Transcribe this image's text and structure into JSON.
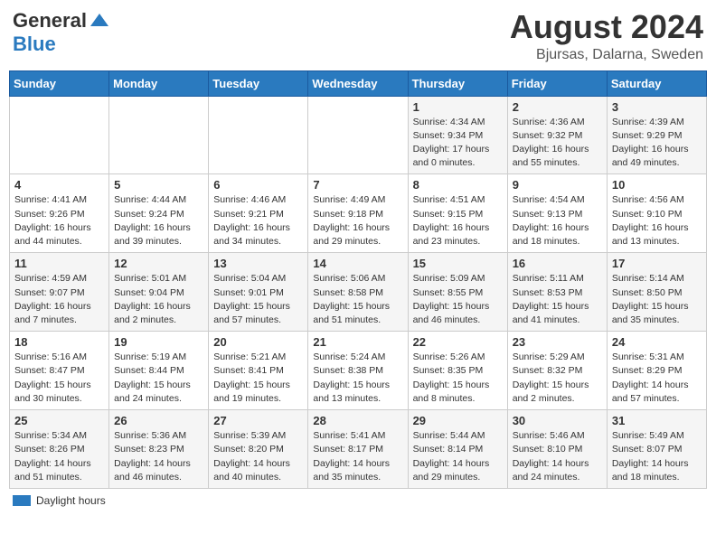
{
  "header": {
    "logo_general": "General",
    "logo_blue": "Blue",
    "month_year": "August 2024",
    "location": "Bjursas, Dalarna, Sweden"
  },
  "legend": {
    "label": "Daylight hours"
  },
  "days_of_week": [
    "Sunday",
    "Monday",
    "Tuesday",
    "Wednesday",
    "Thursday",
    "Friday",
    "Saturday"
  ],
  "weeks": [
    [
      {
        "day": "",
        "info": ""
      },
      {
        "day": "",
        "info": ""
      },
      {
        "day": "",
        "info": ""
      },
      {
        "day": "",
        "info": ""
      },
      {
        "day": "1",
        "info": "Sunrise: 4:34 AM\nSunset: 9:34 PM\nDaylight: 17 hours\nand 0 minutes."
      },
      {
        "day": "2",
        "info": "Sunrise: 4:36 AM\nSunset: 9:32 PM\nDaylight: 16 hours\nand 55 minutes."
      },
      {
        "day": "3",
        "info": "Sunrise: 4:39 AM\nSunset: 9:29 PM\nDaylight: 16 hours\nand 49 minutes."
      }
    ],
    [
      {
        "day": "4",
        "info": "Sunrise: 4:41 AM\nSunset: 9:26 PM\nDaylight: 16 hours\nand 44 minutes."
      },
      {
        "day": "5",
        "info": "Sunrise: 4:44 AM\nSunset: 9:24 PM\nDaylight: 16 hours\nand 39 minutes."
      },
      {
        "day": "6",
        "info": "Sunrise: 4:46 AM\nSunset: 9:21 PM\nDaylight: 16 hours\nand 34 minutes."
      },
      {
        "day": "7",
        "info": "Sunrise: 4:49 AM\nSunset: 9:18 PM\nDaylight: 16 hours\nand 29 minutes."
      },
      {
        "day": "8",
        "info": "Sunrise: 4:51 AM\nSunset: 9:15 PM\nDaylight: 16 hours\nand 23 minutes."
      },
      {
        "day": "9",
        "info": "Sunrise: 4:54 AM\nSunset: 9:13 PM\nDaylight: 16 hours\nand 18 minutes."
      },
      {
        "day": "10",
        "info": "Sunrise: 4:56 AM\nSunset: 9:10 PM\nDaylight: 16 hours\nand 13 minutes."
      }
    ],
    [
      {
        "day": "11",
        "info": "Sunrise: 4:59 AM\nSunset: 9:07 PM\nDaylight: 16 hours\nand 7 minutes."
      },
      {
        "day": "12",
        "info": "Sunrise: 5:01 AM\nSunset: 9:04 PM\nDaylight: 16 hours\nand 2 minutes."
      },
      {
        "day": "13",
        "info": "Sunrise: 5:04 AM\nSunset: 9:01 PM\nDaylight: 15 hours\nand 57 minutes."
      },
      {
        "day": "14",
        "info": "Sunrise: 5:06 AM\nSunset: 8:58 PM\nDaylight: 15 hours\nand 51 minutes."
      },
      {
        "day": "15",
        "info": "Sunrise: 5:09 AM\nSunset: 8:55 PM\nDaylight: 15 hours\nand 46 minutes."
      },
      {
        "day": "16",
        "info": "Sunrise: 5:11 AM\nSunset: 8:53 PM\nDaylight: 15 hours\nand 41 minutes."
      },
      {
        "day": "17",
        "info": "Sunrise: 5:14 AM\nSunset: 8:50 PM\nDaylight: 15 hours\nand 35 minutes."
      }
    ],
    [
      {
        "day": "18",
        "info": "Sunrise: 5:16 AM\nSunset: 8:47 PM\nDaylight: 15 hours\nand 30 minutes."
      },
      {
        "day": "19",
        "info": "Sunrise: 5:19 AM\nSunset: 8:44 PM\nDaylight: 15 hours\nand 24 minutes."
      },
      {
        "day": "20",
        "info": "Sunrise: 5:21 AM\nSunset: 8:41 PM\nDaylight: 15 hours\nand 19 minutes."
      },
      {
        "day": "21",
        "info": "Sunrise: 5:24 AM\nSunset: 8:38 PM\nDaylight: 15 hours\nand 13 minutes."
      },
      {
        "day": "22",
        "info": "Sunrise: 5:26 AM\nSunset: 8:35 PM\nDaylight: 15 hours\nand 8 minutes."
      },
      {
        "day": "23",
        "info": "Sunrise: 5:29 AM\nSunset: 8:32 PM\nDaylight: 15 hours\nand 2 minutes."
      },
      {
        "day": "24",
        "info": "Sunrise: 5:31 AM\nSunset: 8:29 PM\nDaylight: 14 hours\nand 57 minutes."
      }
    ],
    [
      {
        "day": "25",
        "info": "Sunrise: 5:34 AM\nSunset: 8:26 PM\nDaylight: 14 hours\nand 51 minutes."
      },
      {
        "day": "26",
        "info": "Sunrise: 5:36 AM\nSunset: 8:23 PM\nDaylight: 14 hours\nand 46 minutes."
      },
      {
        "day": "27",
        "info": "Sunrise: 5:39 AM\nSunset: 8:20 PM\nDaylight: 14 hours\nand 40 minutes."
      },
      {
        "day": "28",
        "info": "Sunrise: 5:41 AM\nSunset: 8:17 PM\nDaylight: 14 hours\nand 35 minutes."
      },
      {
        "day": "29",
        "info": "Sunrise: 5:44 AM\nSunset: 8:14 PM\nDaylight: 14 hours\nand 29 minutes."
      },
      {
        "day": "30",
        "info": "Sunrise: 5:46 AM\nSunset: 8:10 PM\nDaylight: 14 hours\nand 24 minutes."
      },
      {
        "day": "31",
        "info": "Sunrise: 5:49 AM\nSunset: 8:07 PM\nDaylight: 14 hours\nand 18 minutes."
      }
    ]
  ]
}
